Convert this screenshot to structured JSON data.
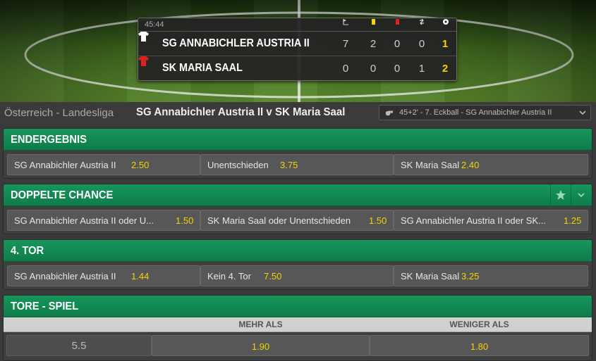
{
  "scoreboard": {
    "clock": "45:44",
    "stat_icons": [
      "corner-flag-icon",
      "yellow-card-icon",
      "red-card-icon",
      "substitution-icon",
      "goal-ball-icon"
    ],
    "teams": [
      {
        "name": "SG ANNABICHLER AUSTRIA II",
        "shirt_color": "#ffffff",
        "corners": "7",
        "yellow": "2",
        "red": "0",
        "subs": "0",
        "goals": "1"
      },
      {
        "name": "SK MARIA SAAL",
        "shirt_color": "#e02020",
        "corners": "0",
        "yellow": "0",
        "red": "0",
        "subs": "1",
        "goals": "2"
      }
    ]
  },
  "header": {
    "breadcrumb": "Österreich - Landesliga",
    "match_title": "SG Annabichler Austria II v SK Maria Saal",
    "last_event": "45+2' - 7. Eckball - SG Annabichler Austria II"
  },
  "markets": {
    "result": {
      "title": "ENDERGEBNIS",
      "selections": [
        {
          "name": "SG Annabichler Austria II",
          "odds": "2.50"
        },
        {
          "name": "Unentschieden",
          "odds": "3.75"
        },
        {
          "name": "SK Maria Saal",
          "odds": "2.40"
        }
      ]
    },
    "double_chance": {
      "title": "DOPPELTE CHANCE",
      "selections": [
        {
          "name": "SG Annabichler Austria II oder U...",
          "odds": "1.50"
        },
        {
          "name": "SK Maria Saal oder Unentschieden",
          "odds": "1.50"
        },
        {
          "name": "SG Annabichler Austria II oder SK...",
          "odds": "1.25"
        }
      ]
    },
    "fourth_goal": {
      "title": "4. TOR",
      "selections": [
        {
          "name": "SG Annabichler Austria II",
          "odds": "1.44"
        },
        {
          "name": "Kein 4. Tor",
          "odds": "7.50"
        },
        {
          "name": "SK Maria Saal",
          "odds": "3.25"
        }
      ]
    },
    "totals": {
      "title": "TORE - SPIEL",
      "over_label": "MEHR ALS",
      "under_label": "WENIGER ALS",
      "line": "5.5",
      "over_odds": "1.90",
      "under_odds": "1.80"
    }
  },
  "colors": {
    "accent_green": "#0f8a52",
    "odds_yellow": "#f5d300"
  }
}
